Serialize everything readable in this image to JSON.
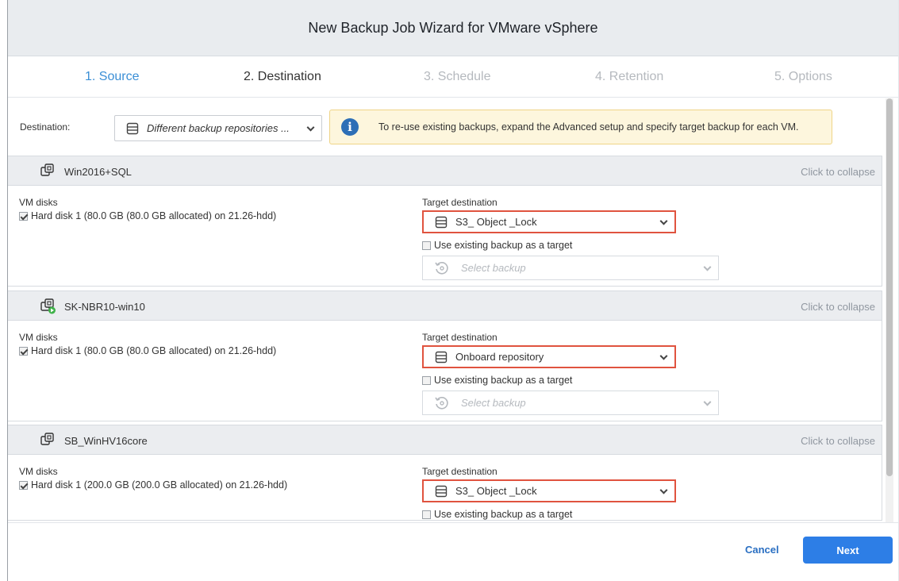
{
  "window": {
    "title": "New Backup Job Wizard for VMware vSphere"
  },
  "steps": [
    {
      "label": "1. Source",
      "state": "done"
    },
    {
      "label": "2. Destination",
      "state": "current"
    },
    {
      "label": "3. Schedule",
      "state": "upcoming"
    },
    {
      "label": "4. Retention",
      "state": "upcoming"
    },
    {
      "label": "5. Options",
      "state": "upcoming"
    }
  ],
  "destination": {
    "label": "Destination:",
    "value": "Different backup repositories ...",
    "icon": "repository-icon"
  },
  "info": {
    "icon": "info-icon",
    "text": "To re-use existing backups, expand the Advanced setup and specify target backup for each VM."
  },
  "vms": [
    {
      "name": "Win2016+SQL",
      "icon": "vm-icon",
      "collapse_label": "Click to collapse",
      "disks_label": "VM disks",
      "disk": "Hard disk 1 (80.0 GB (80.0 GB allocated) on 21.26-hdd)",
      "target_label": "Target destination",
      "target_value": "S3_ Object _Lock",
      "use_existing_label": "Use existing backup as a target",
      "backup_placeholder": "Select backup"
    },
    {
      "name": "SK-NBR10-win10",
      "icon": "vm-running-icon",
      "collapse_label": "Click to collapse",
      "disks_label": "VM disks",
      "disk": "Hard disk 1 (80.0 GB (80.0 GB allocated) on 21.26-hdd)",
      "target_label": "Target destination",
      "target_value": "Onboard repository",
      "use_existing_label": "Use existing backup as a target",
      "backup_placeholder": "Select backup"
    },
    {
      "name": "SB_WinHV16core",
      "icon": "vm-icon",
      "collapse_label": "Click to collapse",
      "disks_label": "VM disks",
      "disk": "Hard disk 1 (200.0 GB (200.0 GB allocated) on 21.26-hdd)",
      "target_label": "Target destination",
      "target_value": "S3_ Object _Lock",
      "use_existing_label": "Use existing backup as a target"
    }
  ],
  "footer": {
    "cancel_label": "Cancel",
    "next_label": "Next"
  },
  "colors": {
    "accent": "#2d7ee6",
    "active_step": "#3b8fd6",
    "highlight_border": "#e0533f",
    "info_bg": "#fdf6dd"
  }
}
